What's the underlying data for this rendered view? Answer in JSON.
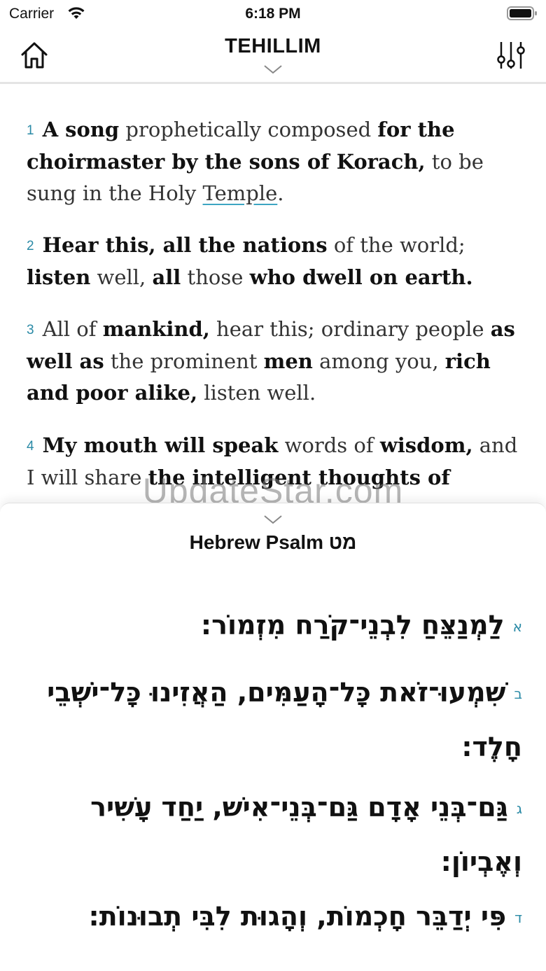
{
  "status_bar": {
    "carrier": "Carrier",
    "time": "6:18 PM"
  },
  "nav": {
    "title": "TEHILLIM"
  },
  "english_verses": [
    {
      "num": "1",
      "parts": [
        {
          "t": "A song",
          "b": true
        },
        {
          "t": " prophetically composed "
        },
        {
          "t": "for the choirmaster by the sons of Korach,",
          "b": true
        },
        {
          "t": " to be sung in the Holy "
        },
        {
          "t": "Temple",
          "link": true
        },
        {
          "t": "."
        }
      ]
    },
    {
      "num": "2",
      "parts": [
        {
          "t": "Hear this, all the nations",
          "b": true
        },
        {
          "t": " of the world; "
        },
        {
          "t": "listen",
          "b": true
        },
        {
          "t": " well, "
        },
        {
          "t": "all",
          "b": true
        },
        {
          "t": " those "
        },
        {
          "t": "who dwell on earth.",
          "b": true
        }
      ]
    },
    {
      "num": "3",
      "parts": [
        {
          "t": "All of "
        },
        {
          "t": "mankind,",
          "b": true
        },
        {
          "t": " hear this; ordinary people "
        },
        {
          "t": "as well as",
          "b": true
        },
        {
          "t": " the prominent "
        },
        {
          "t": "men",
          "b": true
        },
        {
          "t": " among you, "
        },
        {
          "t": "rich and poor alike,",
          "b": true
        },
        {
          "t": " listen well."
        }
      ]
    },
    {
      "num": "4",
      "parts": [
        {
          "t": "My mouth will speak",
          "b": true
        },
        {
          "t": " words of "
        },
        {
          "t": "wisdom,",
          "b": true
        },
        {
          "t": " and I will share "
        },
        {
          "t": "the intelligent thoughts of",
          "b": true
        }
      ]
    }
  ],
  "watermark": "UpdateStar.com",
  "hebrew_panel": {
    "title": "Hebrew Psalm מט",
    "verses": [
      {
        "num": "א",
        "text": "לַמְנַצֵּחַ לִבְנֵי־קֹרַח מִזְמוֹר:"
      },
      {
        "num": "ב",
        "text": "שִׁמְעוּ־זֹאת כָּל־הָעַמִּים, הַאֲזִינוּ כָּל־יֹשְׁבֵי חָלֶד:"
      },
      {
        "num": "ג",
        "text": "גַּם־בְּנֵי אָדָם גַּם־בְּנֵי־אִישׁ, יַחַד עָשִׁיר וְאֶבְיוֹן:"
      },
      {
        "num": "ד",
        "text": "פִּי יְדַבֵּר חָכְמוֹת, וְהָגוּת לִבִּי תְבוּנוֹת:"
      }
    ]
  }
}
